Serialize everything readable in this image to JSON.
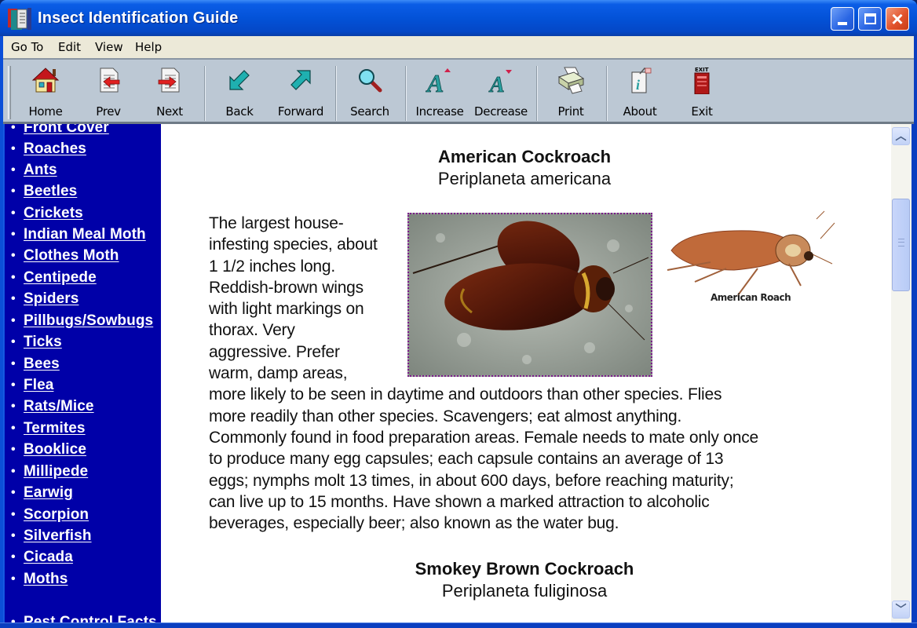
{
  "window": {
    "title": "Insect Identification Guide",
    "controls": {
      "minimize": "minimize",
      "maximize": "maximize",
      "close": "close"
    }
  },
  "menu": {
    "items": [
      "Go To",
      "Edit",
      "View",
      "Help"
    ]
  },
  "toolbar": {
    "buttons": [
      {
        "label": "Home",
        "icon": "home-icon"
      },
      {
        "label": "Prev",
        "icon": "prev-page-icon"
      },
      {
        "label": "Next",
        "icon": "next-page-icon"
      },
      {
        "label": "Back",
        "icon": "back-arrow-icon"
      },
      {
        "label": "Forward",
        "icon": "forward-arrow-icon"
      },
      {
        "label": "Search",
        "icon": "magnifier-icon"
      },
      {
        "label": "Increase",
        "icon": "font-increase-icon"
      },
      {
        "label": "Decrease",
        "icon": "font-decrease-icon"
      },
      {
        "label": "Print",
        "icon": "printer-icon"
      },
      {
        "label": "About",
        "icon": "about-info-icon"
      },
      {
        "label": "Exit",
        "icon": "exit-icon"
      }
    ],
    "exit_icon_text": "EXIT"
  },
  "sidebar": {
    "bullet": "•",
    "items": [
      "Front Cover",
      "Roaches",
      "Ants",
      "Beetles",
      "Crickets",
      "Indian Meal Moth",
      "Clothes Moth",
      "Centipede",
      "Spiders",
      "Pillbugs/Sowbugs",
      "Ticks",
      "Bees",
      "Flea",
      "Rats/Mice",
      "Termites",
      "Booklice",
      "Millipede",
      "Earwig",
      "Scorpion",
      "Silverfish",
      "Cicada",
      "Moths",
      "Pest Control Facts"
    ]
  },
  "content": {
    "entries": [
      {
        "common_name": "American Cockroach",
        "scientific_name": "Periplaneta americana",
        "drawing_caption": "American Roach",
        "description_lines": [
          "The largest house-",
          "infesting species, about",
          "1 1/2 inches long.",
          "Reddish-brown wings",
          "with light markings on",
          "thorax. Very",
          "aggressive. Prefer",
          "warm, damp areas,",
          "more likely to be seen in daytime and outdoors than other species. Flies",
          "more readily than other species. Scavengers; eat almost anything.",
          "Commonly found in food preparation areas. Female needs to mate only once",
          "to produce many egg capsules; each capsule contains an average of 13",
          "eggs; nymphs molt 13 times, in about 600 days, before reaching maturity;",
          "can live up to 15 months. Have shown a marked attraction to alcoholic",
          "beverages, especially beer; also known as the water bug."
        ]
      },
      {
        "common_name": "Smokey Brown Cockroach",
        "scientific_name": "Periplaneta fuliginosa"
      }
    ]
  },
  "scrollbar": {
    "up": "▲",
    "down": "▼",
    "position_fraction": 0.18
  },
  "colors": {
    "sidebar_bg": "#0000a8",
    "title_bar": "#0352d8",
    "toolbar_bg": "#bcc8d4",
    "menu_bg": "#ece9d8",
    "photo_border": "#7a1a8a"
  }
}
